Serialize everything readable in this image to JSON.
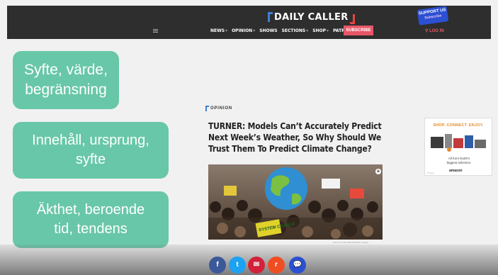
{
  "header": {
    "logo": "DAILY CALLER",
    "support_badge": "SUPPORT US",
    "support_sub": "Subscribe",
    "nav": [
      "NEWS",
      "OPINION",
      "SHOWS",
      "SECTIONS",
      "SHOP",
      "PATRIOTS"
    ],
    "subscribe": "SUBSCRIBE",
    "login": "LOG IN"
  },
  "overlay_boxes": [
    {
      "line1": "Syfte, värde,",
      "line2": "begränsning"
    },
    {
      "line1": "Innehåll, ursprung,",
      "line2": "syfte"
    },
    {
      "line1": "Äkthet, beroende",
      "line2": "tid, tendens"
    }
  ],
  "article": {
    "section": "OPINION",
    "headline": "TURNER: Models Can’t Accurately Predict Next Week’s Weather, So Why Should We Trust Them To Predict Climate Change?",
    "photo_caption": "Photo by Chris Ratcliffe/Getty Images",
    "photo_sign": "SYSTEM CHANGE",
    "photo_expand": "+"
  },
  "ad": {
    "headline": "SHOP. CONNECT. ENJOY.",
    "copy_line1": "All from Earth’s",
    "copy_line2": "biggest selection.",
    "brand": "amazon",
    "label": "Privacy"
  },
  "share": {
    "facebook": "f",
    "twitter": "t",
    "email": "✉",
    "reddit": "r",
    "comment": "💬"
  },
  "colors": {
    "topbar": "#2e2e2e",
    "accent_green": "#68c7a8",
    "subscribe_red": "#e65667",
    "logo_blue": "#3d7fd6",
    "logo_red": "#e64343"
  }
}
